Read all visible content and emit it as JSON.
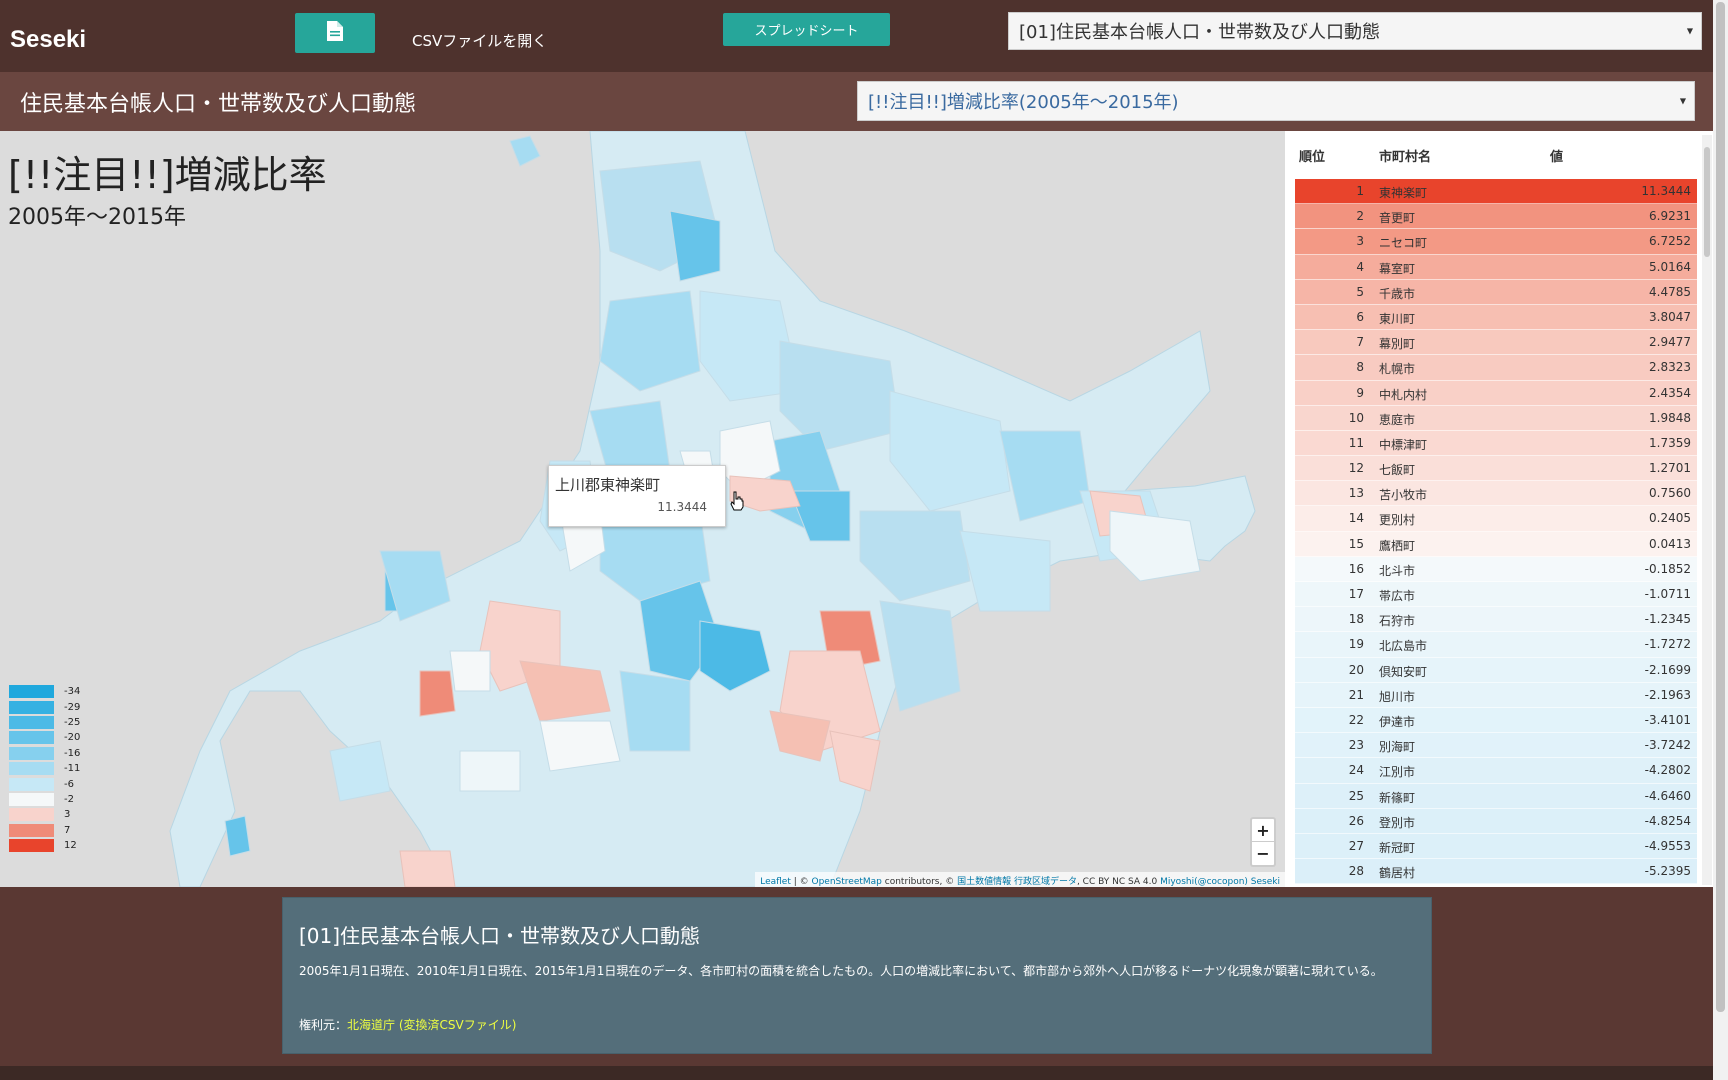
{
  "header": {
    "brand": "Seseki",
    "file_icon": "file-icon",
    "csv_label": "CSVファイルを開く",
    "sheet_button": "スプレッドシート",
    "dataset_select": "[01]住民基本台帳人口・世帯数及び人口動態"
  },
  "subheader": {
    "title": "住民基本台帳人口・世帯数及び人口動態",
    "metric_select": "[!!注目!!]増減比率(2005年～2015年)"
  },
  "map": {
    "title": "[!!注目!!]増減比率",
    "subtitle": "2005年～2015年",
    "tooltip": {
      "name": "上川郡東神楽町",
      "value": "11.3444"
    },
    "legend": [
      {
        "label": "-34",
        "color": "#1fa8dd"
      },
      {
        "label": "-29",
        "color": "#35b1e2"
      },
      {
        "label": "-25",
        "color": "#4cbae6"
      },
      {
        "label": "-20",
        "color": "#66c4ea"
      },
      {
        "label": "-16",
        "color": "#86d0ee"
      },
      {
        "label": "-11",
        "color": "#a6dcf2"
      },
      {
        "label": "-6",
        "color": "#c6e8f6"
      },
      {
        "label": "-2",
        "color": "#f5f8f9"
      },
      {
        "label": "3",
        "color": "#f8d3cc"
      },
      {
        "label": "7",
        "color": "#ef8b78"
      },
      {
        "label": "12",
        "color": "#e8442c"
      }
    ],
    "zoom_in": "+",
    "zoom_out": "−",
    "attribution": {
      "leaflet": "Leaflet",
      "osm_prefix": " | © ",
      "osm": "OpenStreetMap",
      "osm_suffix": " contributors, © ",
      "gsi": "国土数値情報 行政区域データ",
      "license": ", CC BY NC SA 4.0 ",
      "author": "Miyoshi(@cocopon) Seseki"
    }
  },
  "ranking": {
    "headers": {
      "rank": "順位",
      "name": "市町村名",
      "value": "値"
    },
    "rows": [
      {
        "rank": "1",
        "name": "東神楽町",
        "value": "11.3444",
        "color": "#e8442c"
      },
      {
        "rank": "2",
        "name": "音更町",
        "value": "6.9231",
        "color": "#f2937f"
      },
      {
        "rank": "3",
        "name": "ニセコ町",
        "value": "6.7252",
        "color": "#f39985"
      },
      {
        "rank": "4",
        "name": "幕室町",
        "value": "5.0164",
        "color": "#f5ac9c"
      },
      {
        "rank": "5",
        "name": "千歳市",
        "value": "4.4785",
        "color": "#f6b5a7"
      },
      {
        "rank": "6",
        "name": "東川町",
        "value": "3.8047",
        "color": "#f7bfb2"
      },
      {
        "rank": "7",
        "name": "幕別町",
        "value": "2.9477",
        "color": "#f8c9be"
      },
      {
        "rank": "8",
        "name": "札幌市",
        "value": "2.8323",
        "color": "#f8cbc1"
      },
      {
        "rank": "9",
        "name": "中札内村",
        "value": "2.4354",
        "color": "#f9d0c7"
      },
      {
        "rank": "10",
        "name": "恵庭市",
        "value": "1.9848",
        "color": "#f9d6ce"
      },
      {
        "rank": "11",
        "name": "中標津町",
        "value": "1.7359",
        "color": "#fad9d2"
      },
      {
        "rank": "12",
        "name": "七飯町",
        "value": "1.2701",
        "color": "#fadfd9"
      },
      {
        "rank": "13",
        "name": "苫小牧市",
        "value": "0.7560",
        "color": "#fbe6e1"
      },
      {
        "rank": "14",
        "name": "更別村",
        "value": "0.2405",
        "color": "#fcede9"
      },
      {
        "rank": "15",
        "name": "鷹栖町",
        "value": "0.0413",
        "color": "#fcf2ef"
      },
      {
        "rank": "16",
        "name": "北斗市",
        "value": "-0.1852",
        "color": "#f4f9fb"
      },
      {
        "rank": "17",
        "name": "帯広市",
        "value": "-1.0711",
        "color": "#eef7fa"
      },
      {
        "rank": "18",
        "name": "石狩市",
        "value": "-1.2345",
        "color": "#edf6fa"
      },
      {
        "rank": "19",
        "name": "北広島市",
        "value": "-1.7272",
        "color": "#e9f5fa"
      },
      {
        "rank": "20",
        "name": "倶知安町",
        "value": "-2.1699",
        "color": "#e6f4fa"
      },
      {
        "rank": "21",
        "name": "旭川市",
        "value": "-2.1963",
        "color": "#e6f4fa"
      },
      {
        "rank": "22",
        "name": "伊達市",
        "value": "-3.4101",
        "color": "#e2f3fa"
      },
      {
        "rank": "23",
        "name": "別海町",
        "value": "-3.7242",
        "color": "#e1f2fa"
      },
      {
        "rank": "24",
        "name": "江別市",
        "value": "-4.2802",
        "color": "#dff1f9"
      },
      {
        "rank": "25",
        "name": "新篠町",
        "value": "-4.6460",
        "color": "#ddf0f9"
      },
      {
        "rank": "26",
        "name": "登別市",
        "value": "-4.8254",
        "color": "#dcf0f9"
      },
      {
        "rank": "27",
        "name": "新冠町",
        "value": "-4.9553",
        "color": "#dcf0f9"
      },
      {
        "rank": "28",
        "name": "鶴居村",
        "value": "-5.2395",
        "color": "#dbeff9"
      }
    ]
  },
  "info": {
    "title": "[01]住民基本台帳人口・世帯数及び人口動態",
    "description": "2005年1月1日現在、2010年1月1日現在、2015年1月1日現在のデータ、各市町村の面積を統合したもの。人口の増減比率において、都市部から郊外へ人口が移るドーナツ化現象が顕著に現れている。",
    "source_prefix": "権利元：",
    "source_org": "北海道庁",
    "source_link": "(変換済CSVファイル)"
  }
}
